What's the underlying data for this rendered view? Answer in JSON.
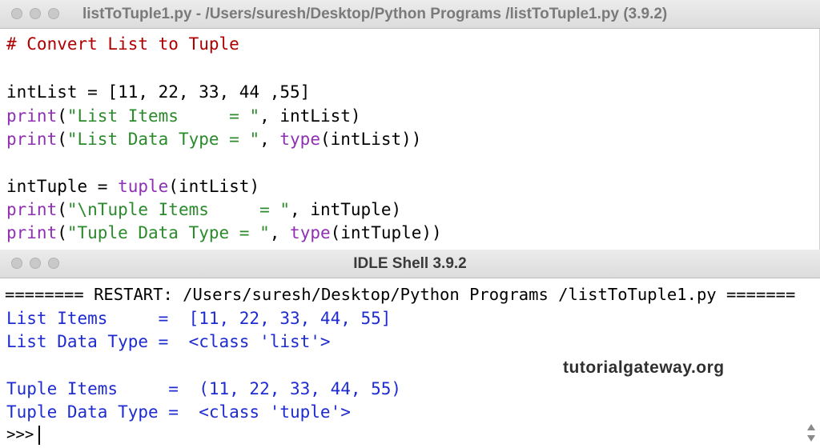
{
  "editor": {
    "title": "listToTuple1.py - /Users/suresh/Desktop/Python Programs /listToTuple1.py (3.9.2)",
    "lines": [
      {
        "comment": "# Convert List to Tuple"
      },
      {
        "a": "intList = [11, 22, 33, 44 ,55]"
      },
      {
        "f": "print",
        "p1": "(",
        "s": "\"List Items     = \"",
        "r": ", intList)"
      },
      {
        "f": "print",
        "p1": "(",
        "s": "\"List Data Type = \"",
        "r": ", ",
        "f2": "type",
        "r2": "(intList))"
      },
      {
        "a": "intTuple = ",
        "f": "tuple",
        "r": "(intList)"
      },
      {
        "f": "print",
        "p1": "(",
        "s": "\"\\nTuple Items     = \"",
        "r": ", intTuple)"
      },
      {
        "f": "print",
        "p1": "(",
        "s": "\"Tuple Data Type = \"",
        "r": ", ",
        "f2": "type",
        "r2": "(intTuple))"
      }
    ]
  },
  "shell": {
    "title": "IDLE Shell 3.9.2",
    "restart": "======== RESTART: /Users/suresh/Desktop/Python Programs /listToTuple1.py =======",
    "out1": "List Items     =  [11, 22, 33, 44, 55]",
    "out2": "List Data Type =  <class 'list'>",
    "out3": "Tuple Items     =  (11, 22, 33, 44, 55)",
    "out4": "Tuple Data Type =  <class 'tuple'>",
    "prompt": ">>>"
  },
  "watermark": "tutorialgateway.org",
  "colors": {
    "comment": "#b00000",
    "builtin": "#8f2fb3",
    "string": "#2b8a2b",
    "output": "#1e2bd0"
  }
}
